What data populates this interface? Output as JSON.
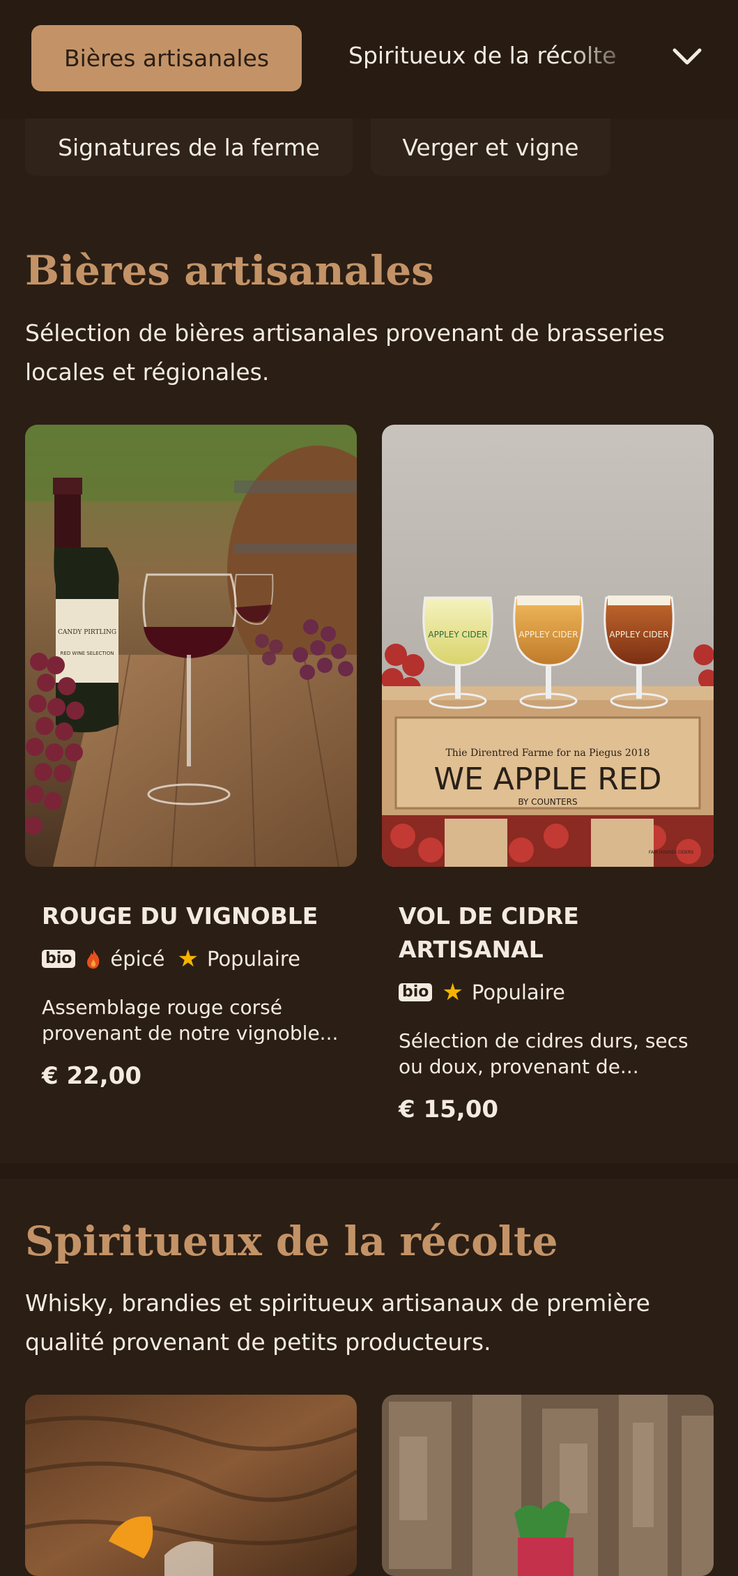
{
  "nav": {
    "active_tab": "Bières artisanales",
    "tab_2": "Spiritueux de la récolte",
    "chip_1": "Signatures de la ferme",
    "chip_2": "Verger et vigne"
  },
  "sections": [
    {
      "title": "Bières artisanales",
      "description": "Sélection de bières artisanales provenant de brasseries locales et régionales.",
      "products": [
        {
          "name": "ROUGE DU VIGNOBLE",
          "tags": {
            "bio": "bio",
            "spicy": "épicé",
            "popular": "Populaire"
          },
          "description": "Assemblage rouge corsé provenant de notre vignoble...",
          "price": "€ 22,00",
          "image_label": {
            "bottle_brand": "CANDY PIRTLING",
            "bottle_text": "RED WINE SELECTION"
          }
        },
        {
          "name": "VOL DE CIDRE ARTISANAL",
          "tags": {
            "bio": "bio",
            "popular": "Populaire"
          },
          "description": "Sélection de cidres durs, secs ou doux, provenant de...",
          "price": "€ 15,00",
          "image_label": {
            "glass_text": "APPLEY CIDER",
            "crate_top": "Thie Direntred Farme for na Piegus 2018",
            "crate_main": "WE APPLE RED",
            "crate_sub": "BY COUNTERS",
            "crate_corner": "FAIR HOUSES CIDERS"
          }
        }
      ]
    },
    {
      "title": "Spiritueux de la récolte",
      "description": "Whisky, brandies et spiritueux artisanaux de première qualité provenant de petits producteurs."
    }
  ],
  "colors": {
    "background": "#2b1e14",
    "accent": "#c39367",
    "text": "#f3ebe2",
    "star": "#f4b400",
    "flame": "#e8501d"
  },
  "icons": {
    "dropdown": "chevron-down-icon",
    "spicy": "flame-icon",
    "popular": "star-icon"
  }
}
